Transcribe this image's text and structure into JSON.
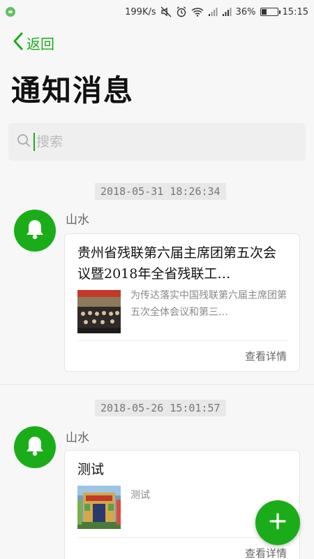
{
  "status_bar": {
    "net_speed": "199K/s",
    "battery_percent": "36%",
    "battery_level": 0.36,
    "time": "15:15",
    "icons": [
      "wechat-icon",
      "mute-icon",
      "alarm-icon",
      "wifi-icon",
      "signal-icon",
      "signal-icon",
      "battery-icon"
    ]
  },
  "nav": {
    "back_label": "返回"
  },
  "page": {
    "title": "通知消息"
  },
  "search": {
    "placeholder": "搜索"
  },
  "messages": [
    {
      "timestamp": "2018-05-31  18:26:34",
      "sender": "山水",
      "title": "贵州省残联第六届主席团第五次会议暨2018年全省残联工…",
      "description": "为传达落实中国残联第六届主席团第五次全体会议和第三…",
      "detail_label": "查看详情"
    },
    {
      "timestamp": "2018-05-26  15:01:57",
      "sender": "山水",
      "title": "测试",
      "description": "测试",
      "detail_label": "查看详情"
    }
  ],
  "colors": {
    "accent": "#1aad19"
  }
}
